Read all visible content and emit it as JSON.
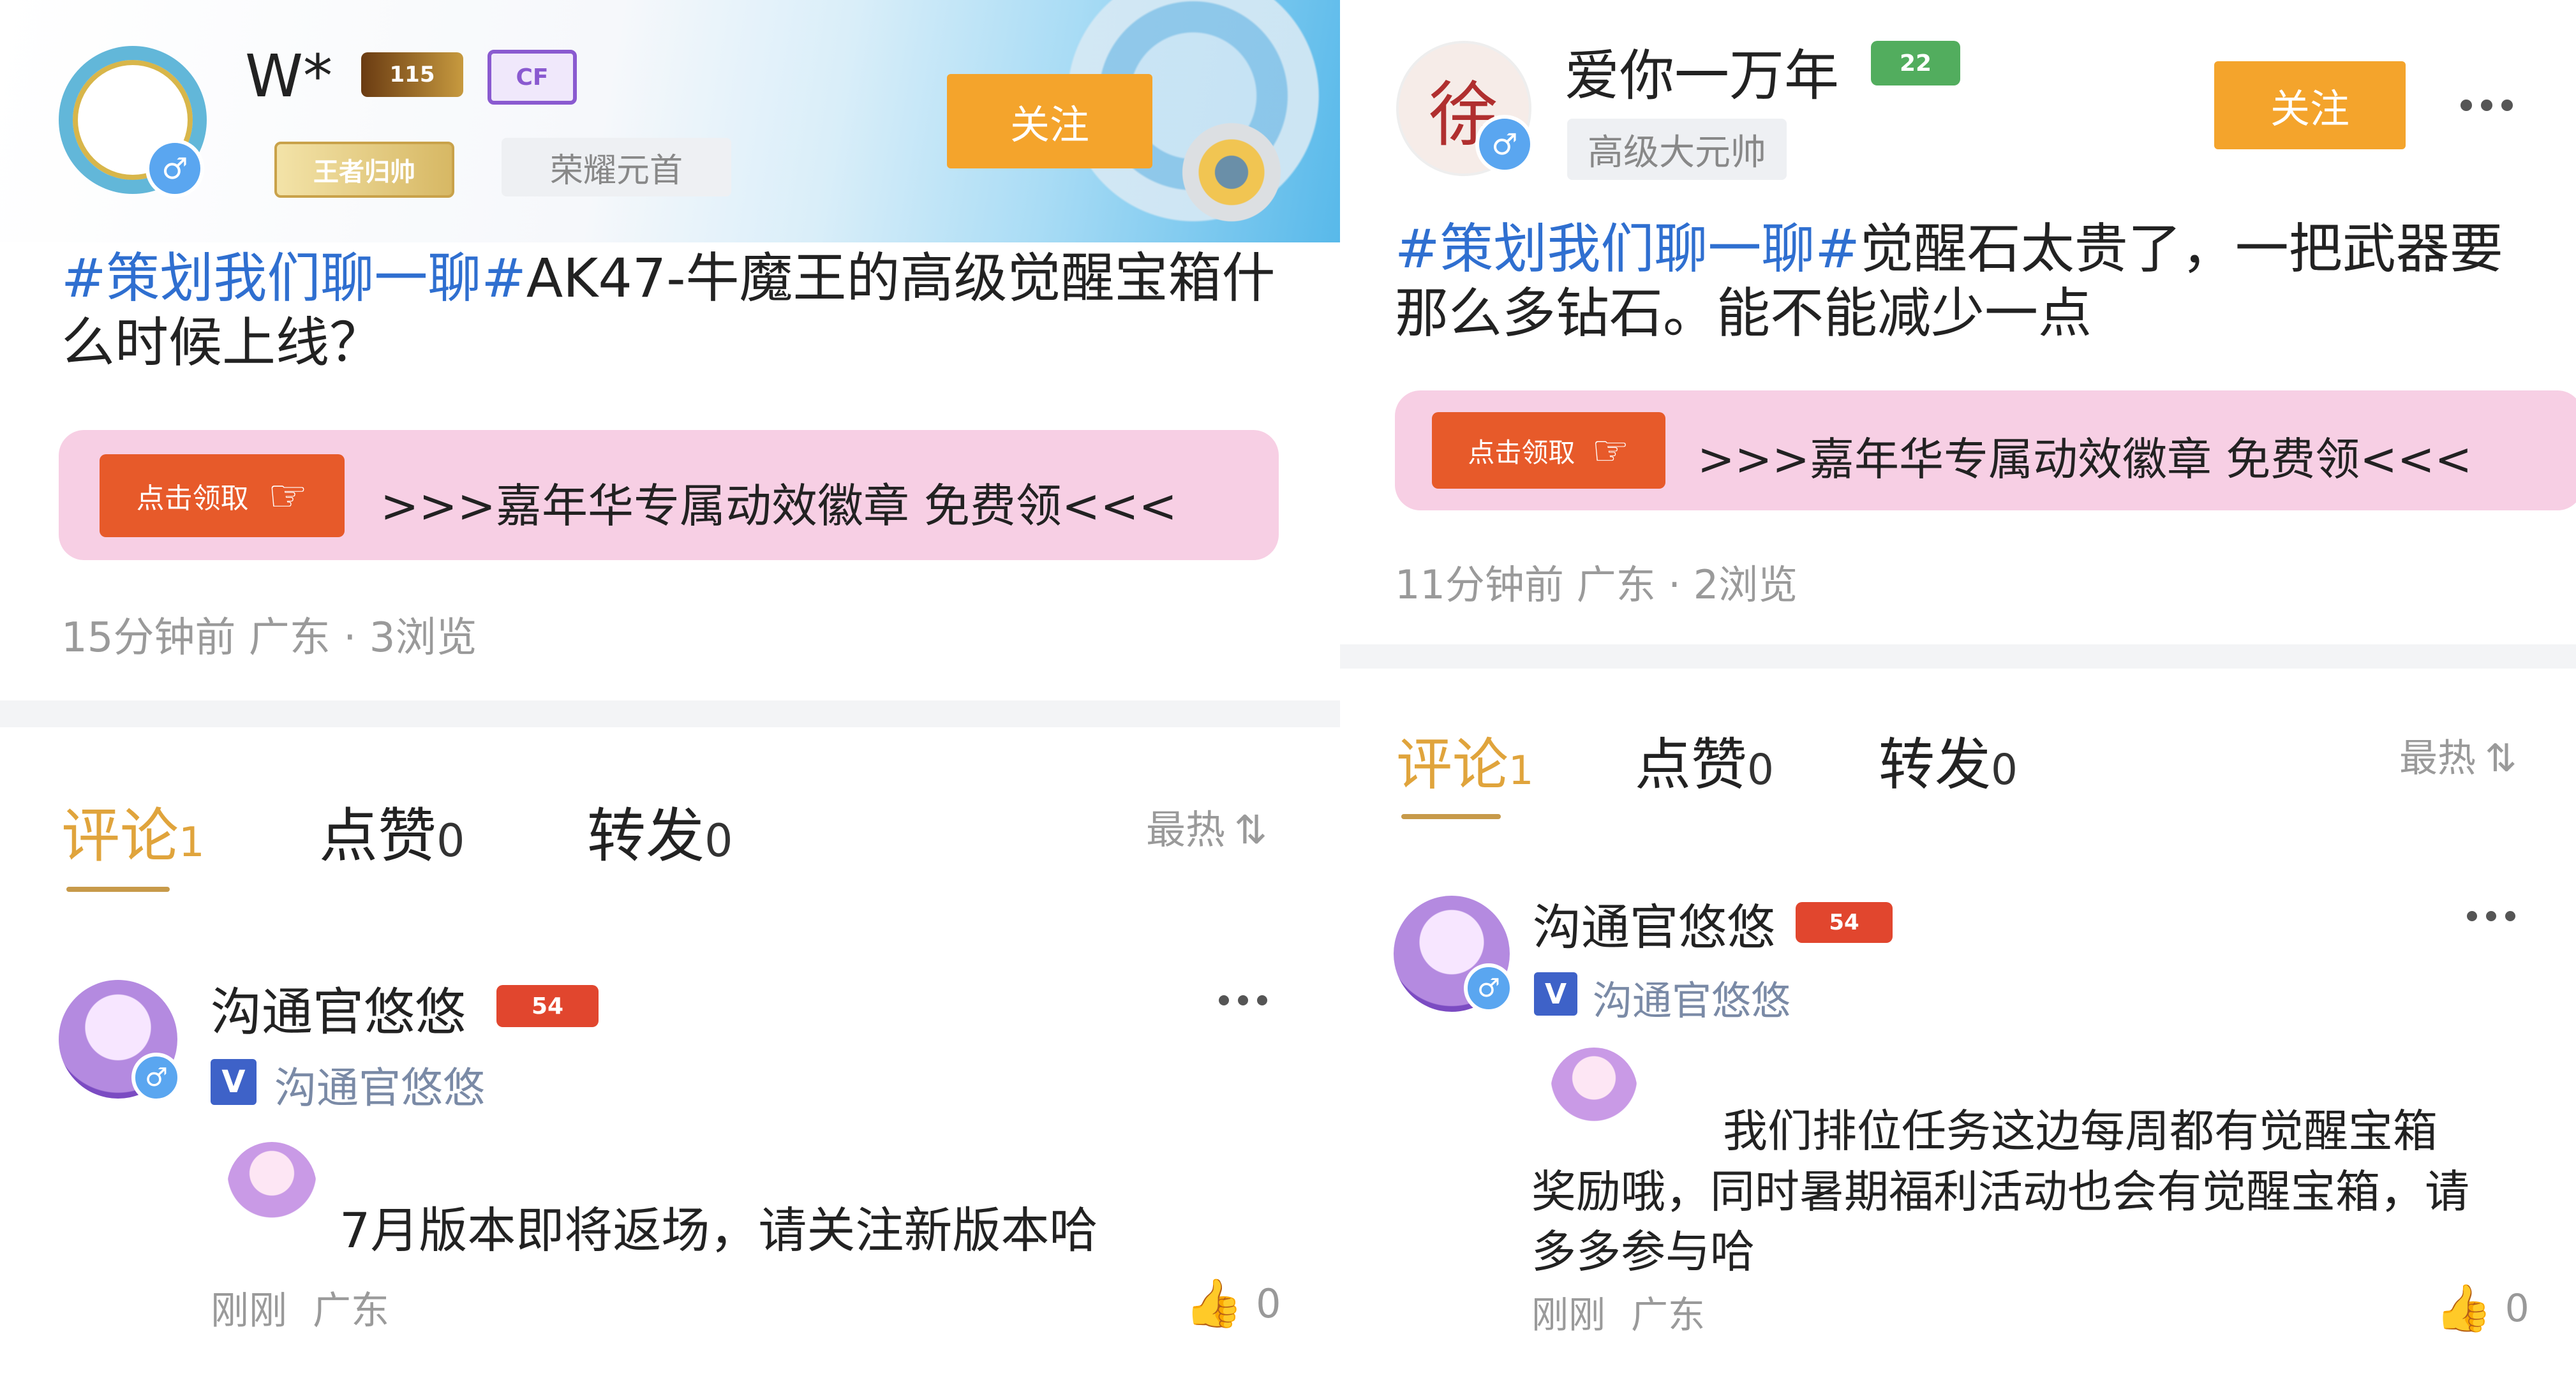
{
  "left": {
    "author": {
      "name": "W*",
      "level": "115",
      "badge": "王者归帅",
      "title": "荣耀元首",
      "gender": "♂"
    },
    "follow_label": "关注",
    "post": {
      "tag": "#策划我们聊一聊#",
      "text": "AK47-牛魔王的高级觉醒宝箱什么时候上线？"
    },
    "promo": {
      "badge_text": "点击领取",
      "text": ">>>嘉年华专属动效徽章 免费领<<<"
    },
    "meta": "15分钟前 广东 · 3浏览",
    "tabs": [
      {
        "label": "评论",
        "count": "1"
      },
      {
        "label": "点赞",
        "count": "0"
      },
      {
        "label": "转发",
        "count": "0"
      }
    ],
    "sort_label": "最热",
    "comment": {
      "name": "沟通官悠悠",
      "level": "54",
      "verified_name": "沟通官悠悠",
      "gender": "♂",
      "text": "7月版本即将返场，请关注新版本哈",
      "time": "刚刚",
      "location": "广东",
      "likes": "0"
    }
  },
  "right": {
    "author": {
      "name": "爱你一万年",
      "level": "22",
      "title": "高级大元帅",
      "gender": "♂",
      "avatar_char": "徐"
    },
    "follow_label": "关注",
    "post": {
      "tag": "#策划我们聊一聊#",
      "text": "觉醒石太贵了，一把武器要那么多钻石。能不能减少一点"
    },
    "promo": {
      "badge_text": "点击领取",
      "text": ">>>嘉年华专属动效徽章 免费领<<<"
    },
    "meta": "11分钟前 广东 · 2浏览",
    "tabs": [
      {
        "label": "评论",
        "count": "1"
      },
      {
        "label": "点赞",
        "count": "0"
      },
      {
        "label": "转发",
        "count": "0"
      }
    ],
    "sort_label": "最热",
    "comment": {
      "name": "沟通官悠悠",
      "level": "54",
      "verified_name": "沟通官悠悠",
      "gender": "♂",
      "text": "我们排位任务这边每周都有觉醒宝箱奖励哦，同时暑期福利活动也会有觉醒宝箱，请多多参与哈",
      "time": "刚刚",
      "location": "广东",
      "likes": "0"
    }
  },
  "colors": {
    "accent": "#f4a42c",
    "tag_blue": "#2f6fd0",
    "promo_bg": "#f7cfe4",
    "tab_active": "#e0a43c"
  },
  "icons": [
    "gender-male-icon",
    "more-icon",
    "sort-icon",
    "thumbs-up-icon",
    "verified-icon",
    "hand-pointer-icon"
  ]
}
